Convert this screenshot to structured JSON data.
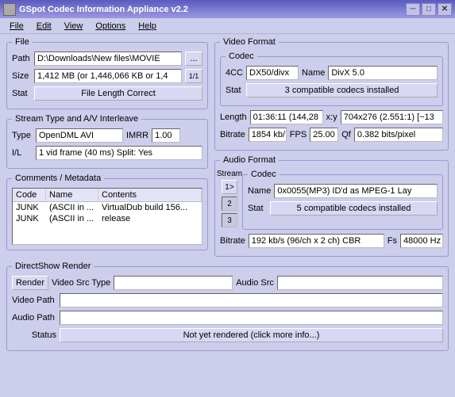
{
  "window": {
    "title": "GSpot Codec Information Appliance  v2.2"
  },
  "menu": {
    "file": "File",
    "edit": "Edit",
    "view": "View",
    "options": "Options",
    "help": "Help"
  },
  "file": {
    "legend": "File",
    "path_label": "Path",
    "path": "D:\\Downloads\\New files\\MOVIE",
    "browse": "...",
    "size_label": "Size",
    "size": "1,412 MB (or 1,446,066 KB or 1,4",
    "index_btn": "1/1",
    "stat_label": "Stat",
    "stat": "File Length Correct"
  },
  "stream": {
    "legend": "Stream Type and A/V Interleave",
    "type_label": "Type",
    "type": "OpenDML AVI",
    "imrr_label": "IMRR",
    "imrr": "1.00",
    "il_label": "I/L",
    "il": "1 vid frame (40 ms)  Split: Yes"
  },
  "comments": {
    "legend": "Comments / Metadata",
    "headers": {
      "code": "Code",
      "name": "Name",
      "contents": "Contents"
    },
    "rows": [
      {
        "code": "JUNK",
        "name": "(ASCII in ...",
        "contents": "VirtualDub build 156..."
      },
      {
        "code": "JUNK",
        "name": "(ASCII in ...",
        "contents": "release"
      }
    ]
  },
  "video": {
    "legend": "Video Format",
    "codec_legend": "Codec",
    "fourcc_label": "4CC",
    "fourcc": "DX50/divx",
    "name_label": "Name",
    "name": "DivX 5.0",
    "stat_label": "Stat",
    "stat": "3 compatible codecs installed",
    "length_label": "Length",
    "length": "01:36:11 (144,28",
    "xy_label": "x:y",
    "xy": "704x276 (2.551:1) [~13",
    "bitrate_label": "Bitrate",
    "bitrate": "1854 kb/",
    "fps_label": "FPS",
    "fps": "25.00",
    "qf_label": "Qf",
    "qf": "0.382 bits/pixel"
  },
  "audio": {
    "legend": "Audio Format",
    "stream_label": "Stream",
    "codec_legend": "Codec",
    "s1": "1>",
    "s2": "2",
    "s3": "3",
    "name_label": "Name",
    "name": "0x0055(MP3) ID'd as MPEG-1 Lay",
    "stat_label": "Stat",
    "stat": "5 compatible codecs installed",
    "bitrate_label": "Bitrate",
    "bitrate": "192 kb/s (96/ch x 2 ch) CBR",
    "fs_label": "Fs",
    "fs": "48000 Hz"
  },
  "ds": {
    "legend": "DirectShow Render",
    "render_btn": "Render",
    "vst_label": "Video Src Type",
    "vst": "",
    "as_label": "Audio Src",
    "as": "",
    "vp_label": "Video Path",
    "vp": "",
    "ap_label": "Audio Path",
    "ap": "",
    "status_label": "Status",
    "status": "Not yet rendered (click more info...)"
  }
}
